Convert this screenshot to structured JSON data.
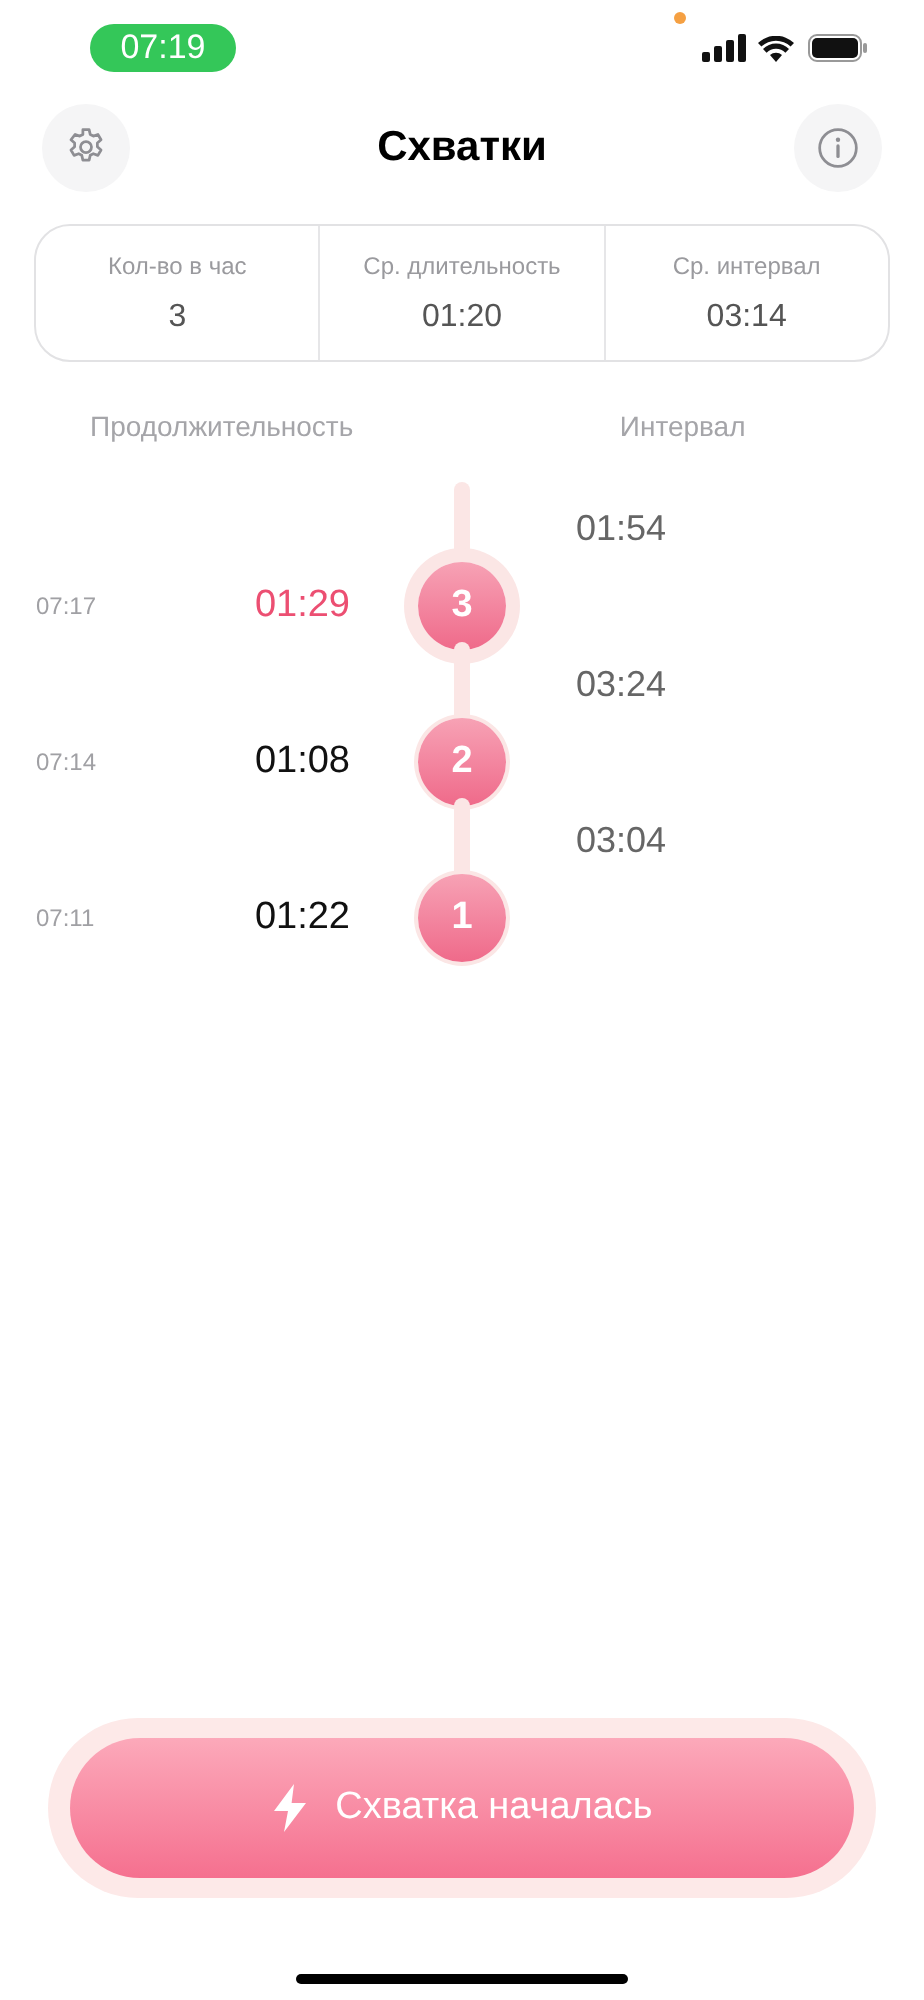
{
  "status_bar": {
    "time": "07:19",
    "recording_dot": true
  },
  "header": {
    "title": "Схватки"
  },
  "stats": [
    {
      "label": "Кол-во в час",
      "value": "3"
    },
    {
      "label": "Ср. длительность",
      "value": "01:20"
    },
    {
      "label": "Ср. интервал",
      "value": "03:14"
    }
  ],
  "columns": {
    "duration": "Продолжительность",
    "interval": "Интервал"
  },
  "timeline": [
    {
      "kind": "interval",
      "value": "01:54"
    },
    {
      "kind": "contraction",
      "start": "07:17",
      "duration": "01:29",
      "number": "3",
      "current": true
    },
    {
      "kind": "interval",
      "value": "03:24"
    },
    {
      "kind": "contraction",
      "start": "07:14",
      "duration": "01:08",
      "number": "2",
      "current": false
    },
    {
      "kind": "interval",
      "value": "03:04"
    },
    {
      "kind": "contraction",
      "start": "07:11",
      "duration": "01:22",
      "number": "1",
      "current": false
    }
  ],
  "action_button": {
    "label": "Схватка началась"
  }
}
